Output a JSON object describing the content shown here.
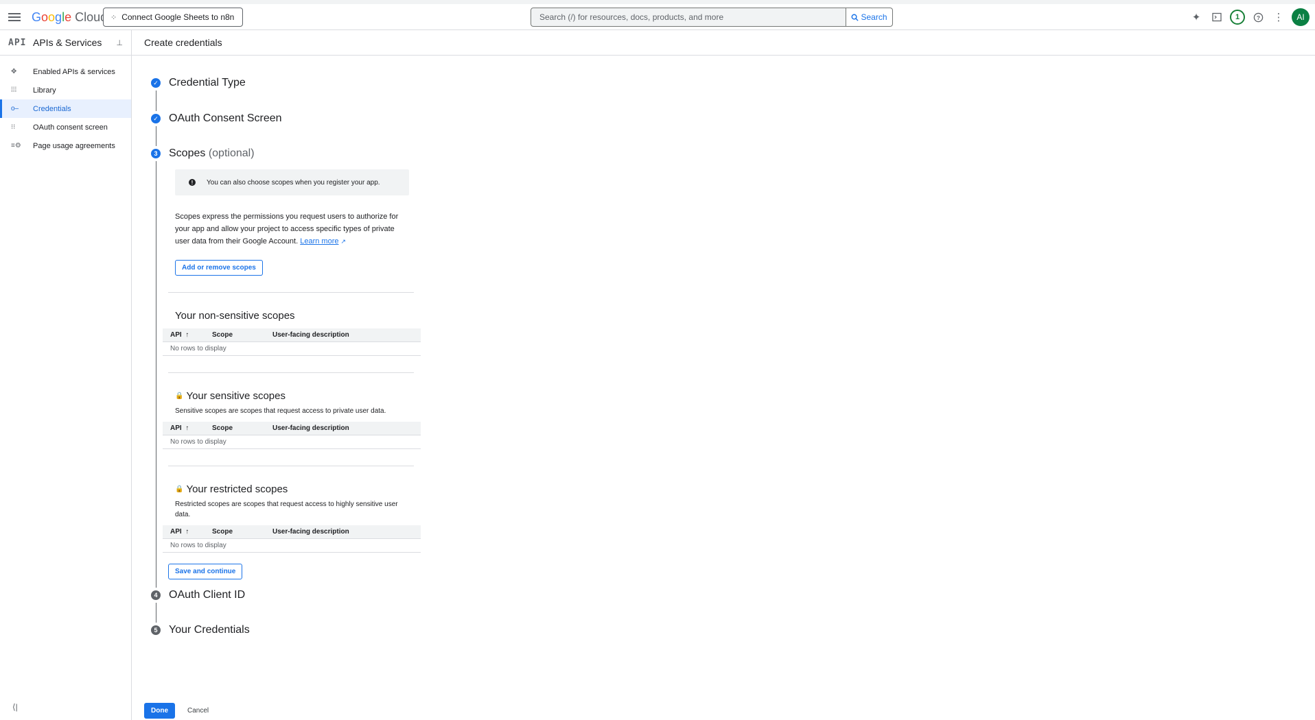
{
  "topbar": {
    "logo_google": "Google",
    "logo_cloud": "Cloud",
    "project_name": "Connect Google Sheets to n8n",
    "search_placeholder": "Search (/) for resources, docs, products, and more",
    "search_button": "Search",
    "notification_count": "1",
    "avatar_initials": "AI"
  },
  "sidebar": {
    "logo": "API",
    "title": "APIs & Services",
    "items": [
      {
        "label": "Enabled APIs & services"
      },
      {
        "label": "Library"
      },
      {
        "label": "Credentials"
      },
      {
        "label": "OAuth consent screen"
      },
      {
        "label": "Page usage agreements"
      }
    ]
  },
  "page": {
    "title": "Create credentials"
  },
  "steps": [
    {
      "label": "Credential Type",
      "marker": "✓"
    },
    {
      "label": "OAuth Consent Screen",
      "marker": "✓"
    },
    {
      "label": "Scopes",
      "optional": "(optional)",
      "marker": "3"
    },
    {
      "label": "OAuth Client ID",
      "marker": "4"
    },
    {
      "label": "Your Credentials",
      "marker": "5"
    }
  ],
  "scopes": {
    "info": "You can also choose scopes when you register your app.",
    "description": "Scopes express the permissions you request users to authorize for your app and allow your project to access specific types of private user data from their Google Account.",
    "learn_more": "Learn more",
    "add_button": "Add or remove scopes",
    "table_headers": {
      "api": "API",
      "scope": "Scope",
      "description": "User-facing description"
    },
    "empty_text": "No rows to display",
    "non_sensitive": {
      "title": "Your non-sensitive scopes"
    },
    "sensitive": {
      "title": "Your sensitive scopes",
      "subtitle": "Sensitive scopes are scopes that request access to private user data."
    },
    "restricted": {
      "title": "Your restricted scopes",
      "subtitle": "Restricted scopes are scopes that request access to highly sensitive user data."
    },
    "save_button": "Save and continue"
  },
  "footer": {
    "done": "Done",
    "cancel": "Cancel"
  }
}
